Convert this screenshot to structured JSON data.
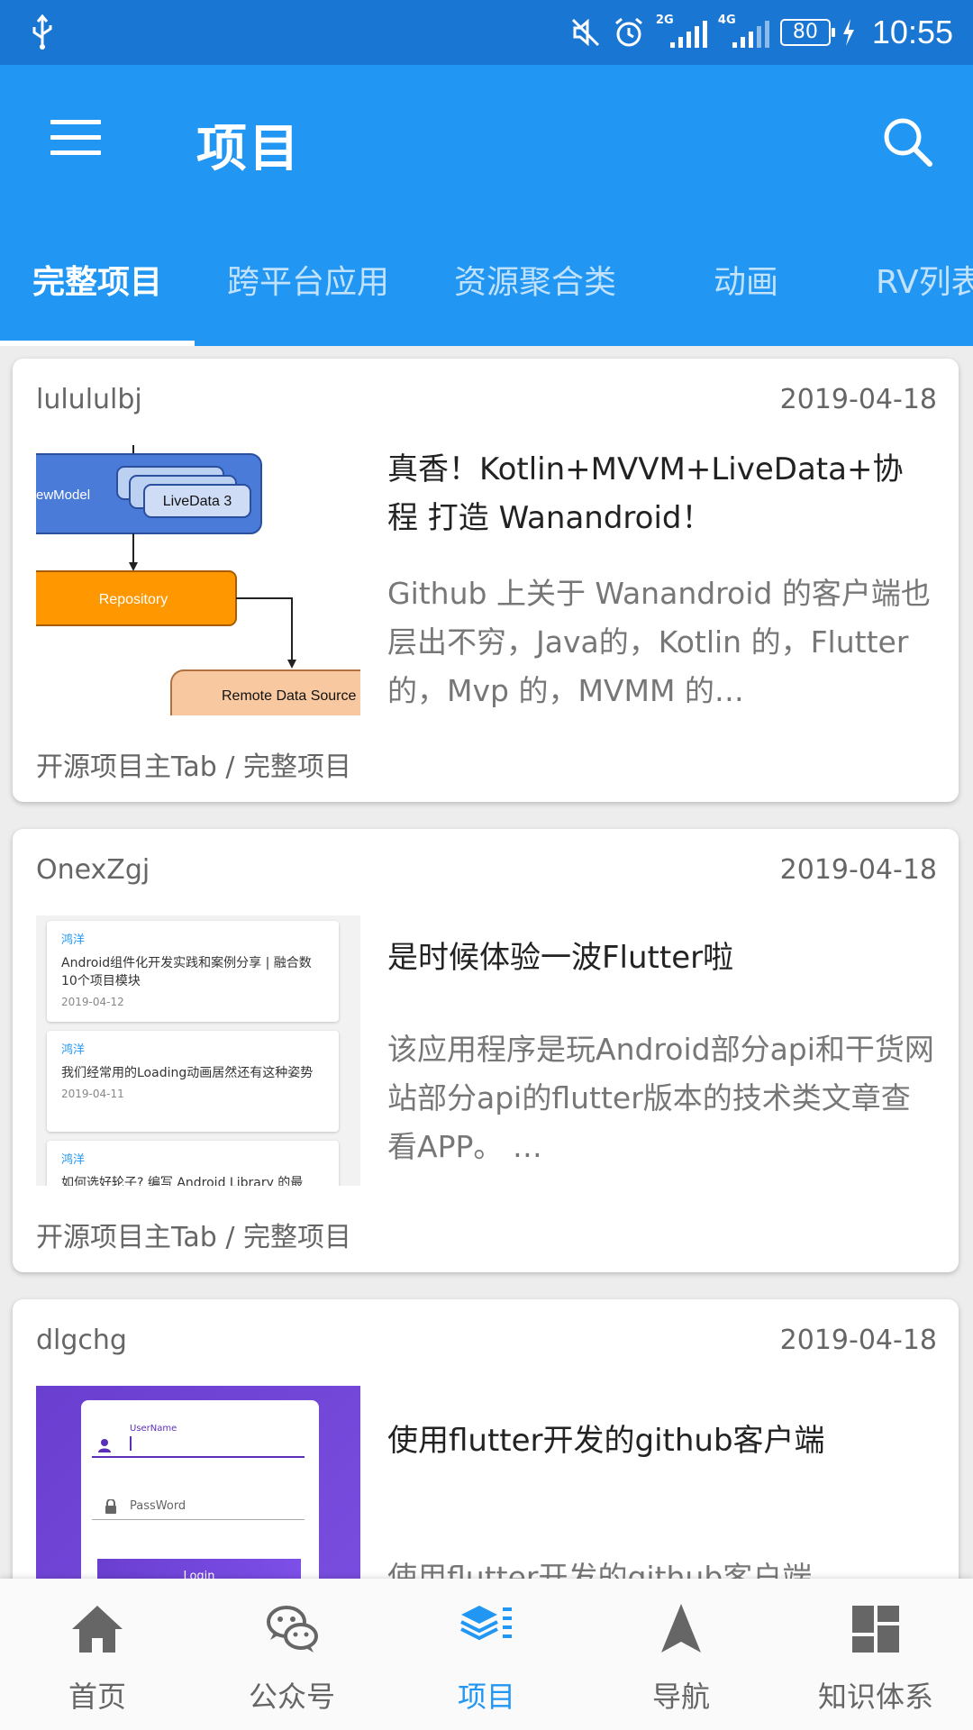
{
  "status_bar": {
    "time": "10:55",
    "battery": "80",
    "net1": "2G",
    "net2": "4G"
  },
  "app_bar": {
    "title": "项目"
  },
  "tabs": [
    {
      "label": "完整项目",
      "active": true
    },
    {
      "label": "跨平台应用",
      "active": false
    },
    {
      "label": "资源聚合类",
      "active": false
    },
    {
      "label": "动画",
      "active": false
    },
    {
      "label": "RV列表",
      "active": false
    }
  ],
  "cards": [
    {
      "author": "lulululbj",
      "date": "2019-04-18",
      "title": "真香！Kotlin+MVVM+LiveData+协程 打造 Wanandroid！",
      "desc": "Github 上关于 Wanandroid 的客户端也层出不穷，Java的，Kotlin 的，Flutter 的，Mvp 的，MVMM 的…",
      "chapter": "开源项目主Tab / 完整项目",
      "thumb": {
        "viewmodel": "ewModel",
        "livedata": "LiveData 3",
        "repository": "Repository",
        "remote": "Remote Data Source"
      }
    },
    {
      "author": "OnexZgj",
      "date": "2019-04-18",
      "title": "是时候体验一波Flutter啦",
      "desc": "该应用程序是玩Android部分api和干货网站部分api的flutter版本的技术类文章查看APP。 …",
      "chapter": "开源项目主Tab / 完整项目",
      "thumb": {
        "items": [
          {
            "author": "鸿洋",
            "title": "Android组件化开发实践和案例分享 | 融合数10个项目模块",
            "date": "2019-04-12"
          },
          {
            "author": "鸿洋",
            "title": "我们经常用的Loading动画居然还有这种姿势",
            "date": "2019-04-11"
          },
          {
            "author": "鸿洋",
            "title": "如何选好轮子? 编写 Android Library 的最",
            "date": ""
          }
        ]
      }
    },
    {
      "author": "dlgchg",
      "date": "2019-04-18",
      "title": "使用flutter开发的github客户端",
      "desc": "使用flutter开发的github客户端",
      "chapter": "",
      "thumb": {
        "username": "UserName",
        "password": "PassWord",
        "login": "Login"
      }
    }
  ],
  "bottom_nav": [
    {
      "label": "首页",
      "icon": "home-icon",
      "active": false
    },
    {
      "label": "公众号",
      "icon": "wechat-icon",
      "active": false
    },
    {
      "label": "项目",
      "icon": "layers-icon",
      "active": true
    },
    {
      "label": "导航",
      "icon": "navigation-arrow-icon",
      "active": false
    },
    {
      "label": "知识体系",
      "icon": "dashboard-icon",
      "active": false
    }
  ],
  "colors": {
    "primary": "#2196f3",
    "status_bar": "#1976d2",
    "orange": "#ff9800",
    "purple": "#6a3fd0"
  }
}
